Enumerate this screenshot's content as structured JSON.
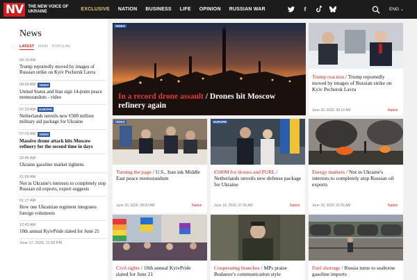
{
  "header": {
    "logo_mark": "NV",
    "logo_text": "THE NEW VOICE OF UKRAINE",
    "nav": [
      "EXCLUSIVE",
      "NATION",
      "BUSINESS",
      "LIFE",
      "OPINION",
      "RUSSIAN WAR"
    ],
    "language": "ENG ⌄",
    "social_icons": [
      "twitter-icon",
      "facebook-icon",
      "tiktok-icon",
      "bluesky-icon"
    ],
    "accent_color": "#d11e1e",
    "active_nav_color": "#e9c46a"
  },
  "sidebar": {
    "title": "News",
    "tabs": [
      "LATEST",
      "MAIN",
      "POPULAR"
    ],
    "items": [
      {
        "time": "09:10 AM",
        "badge": "",
        "text": "Trump reportedly moved by images of Russian strike on Kyiv Pechersk Lavra",
        "bold": false
      },
      {
        "time": "08:00 AM",
        "badge": "VIDEO",
        "text": "United States and Iran sign 14-point peace memorandum - video",
        "bold": false
      },
      {
        "time": "07:33 AM",
        "badge": "EUROPE",
        "text": "Netherlands unveils new €500 million military aid package for Ukraine",
        "bold": false
      },
      {
        "time": "07:03 AM",
        "badge": "VIDEO",
        "text": "Massive drone attack hits Moscow refinery for the second time in days",
        "bold": true
      },
      {
        "time": "02:45 AM",
        "badge": "",
        "text": "Ukraine gasoline market tightens",
        "bold": false
      },
      {
        "time": "01:56 AM",
        "badge": "",
        "text": "Not in Ukraine's interests to completely stop Russian oil exports, expert suggests",
        "bold": false
      },
      {
        "time": "01:17 AM",
        "badge": "",
        "text": "How one Ukrainian regiment integrates foreign volunteers",
        "bold": false
      },
      {
        "time": "12:43 AM",
        "badge": "",
        "text": "10th annual KyivPride slated for June 21",
        "bold": false
      },
      {
        "time": "June 17, 2026, 11:58 PM",
        "badge": "",
        "text": "",
        "bold": false
      }
    ]
  },
  "cards": {
    "hero": {
      "badge": "VIDEO",
      "category": "In a record drone assault",
      "title": "Drones hit Moscow refinery again"
    },
    "trump": {
      "category": "Trump reaction",
      "title": "Trump reportedly moved by images of Russian strike on Kyiv Pechersk Lavra",
      "date": "June 18, 2026, 09:10 AM",
      "tag": "Nation"
    },
    "iran": {
      "badge": "VIDEO",
      "category": "Turning the page",
      "title": "U.S., Iran ink Middle East peace memorandum",
      "date": "June 18, 2026, 08:00 AM",
      "tag": "Nation"
    },
    "netherlands": {
      "badge": "EUROPE",
      "category": "€500M for drones and PURL",
      "title": "Netherlands unveils new defense package for Ukraine",
      "date": "June 18, 2026, 07:35 AM",
      "tag": "Nation"
    },
    "oil": {
      "category": "Energy markets",
      "title": "Not in Ukraine's interests to completely stop Russian oil exports",
      "date": "June 18, 2026, 01:56 AM",
      "tag": "Nation"
    },
    "pride": {
      "category": "Civil rights",
      "title": "10th annual KyivPride slated for June 21"
    },
    "budanov": {
      "category": "Cooperating branches",
      "title": "MPs praise Budanov's communication style"
    },
    "fuel": {
      "category": "Fuel shortage",
      "title": "Russia turns to seaborne gasoline imports"
    }
  }
}
